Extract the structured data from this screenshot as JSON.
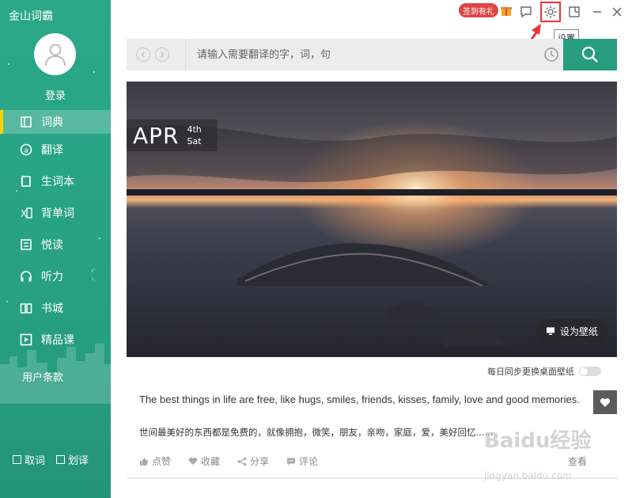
{
  "app": {
    "title": "金山词霸"
  },
  "user": {
    "login_label": "登录"
  },
  "sidebar": {
    "items": [
      {
        "label": "词典",
        "icon": "dictionary-icon"
      },
      {
        "label": "翻译",
        "icon": "translate-icon"
      },
      {
        "label": "生词本",
        "icon": "wordbook-icon"
      },
      {
        "label": "背单词",
        "icon": "memorize-icon"
      },
      {
        "label": "悦读",
        "icon": "reading-icon"
      },
      {
        "label": "听力",
        "icon": "headphones-icon"
      },
      {
        "label": "书城",
        "icon": "book-icon"
      },
      {
        "label": "精品课",
        "icon": "play-icon"
      }
    ],
    "terms_label": "用户条款",
    "options": {
      "copy_word": "取词",
      "select_translate": "划译"
    }
  },
  "topbar": {
    "sign_badge": "签到有礼",
    "tooltip": "设置"
  },
  "search": {
    "placeholder": "请输入需要翻译的字，词，句"
  },
  "card": {
    "month": "APR",
    "day": "4th",
    "weekday": "Sat",
    "wallpaper_btn": "设为壁纸",
    "sync_label": "每日同步更换桌面壁纸",
    "sync_enabled": false,
    "quote_en": "The best things in life are free, like hugs, smiles, friends, kisses, family, love and good memories.",
    "quote_cn": "世间最美好的东西都是免费的，就像拥抱，微笑，朋友，亲吻，家庭，爱，美好回忆......",
    "actions": {
      "like": "点赞",
      "favorite": "收藏",
      "share": "分享",
      "comment": "评论"
    },
    "more_label": "查看"
  },
  "watermark": {
    "text": "Baidu经验",
    "sub": "jingyan.baidu.com"
  },
  "colors": {
    "sidebar": "#27a083",
    "accent": "#279d7f",
    "badge": "#e24444",
    "active_marker": "#ffd400"
  }
}
